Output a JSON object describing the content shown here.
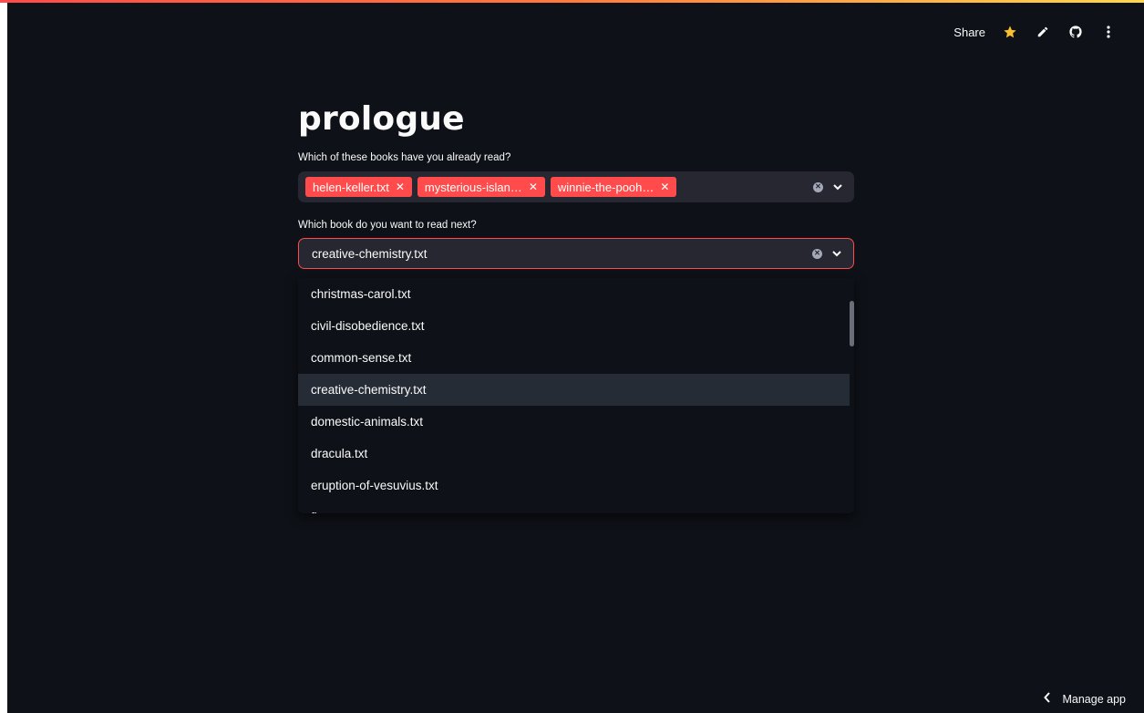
{
  "app": {
    "title": "prologue"
  },
  "toolbar": {
    "share_label": "Share",
    "icons": [
      "star-icon",
      "pencil-icon",
      "github-icon",
      "more-vertical-icon"
    ],
    "star_color": "#f9c02c"
  },
  "read_books": {
    "label": "Which of these books have you already read?",
    "tags": [
      "helen-keller.txt",
      "mysterious-islan…",
      "winnie-the-pooh…"
    ]
  },
  "next_book": {
    "label": "Which book do you want to read next?",
    "value": "creative-chemistry.txt",
    "options": [
      "christmas-carol.txt",
      "civil-disobedience.txt",
      "common-sense.txt",
      "creative-chemistry.txt",
      "domestic-animals.txt",
      "dracula.txt",
      "eruption-of-vesuvius.txt",
      "fi…"
    ],
    "active_option": "creative-chemistry.txt"
  },
  "footer": {
    "manage_label": "Manage app"
  },
  "colors": {
    "background": "#0e1117",
    "accent": "#ff4b4b",
    "input_bg": "#262730"
  }
}
